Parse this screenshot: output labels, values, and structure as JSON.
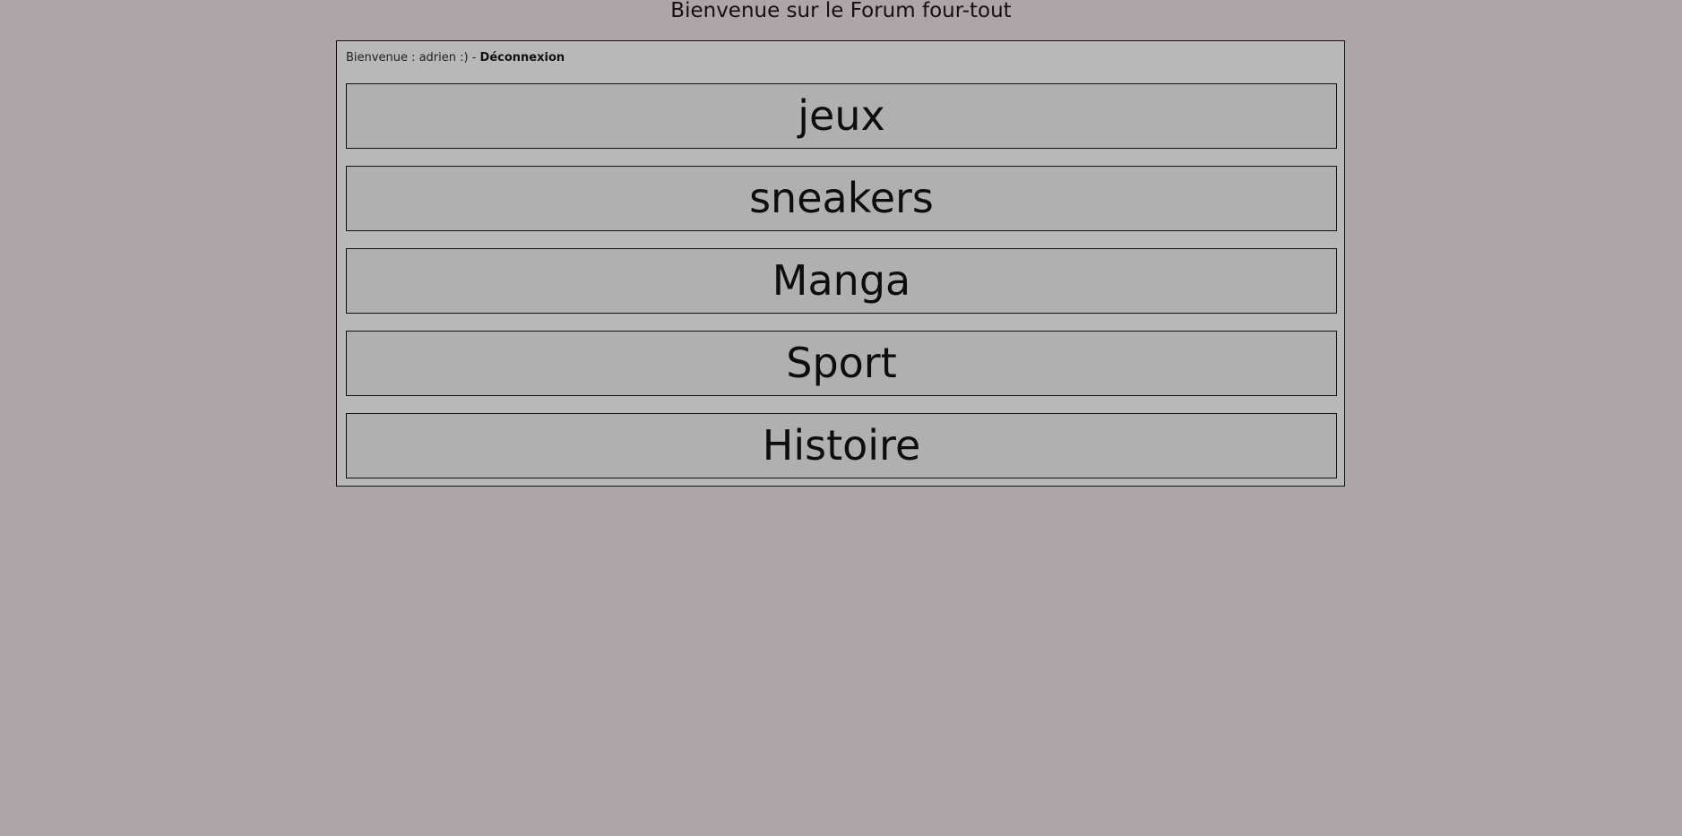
{
  "header": {
    "title": "Bienvenue sur le Forum four-tout"
  },
  "welcome": {
    "greeting": "Bienvenue : adrien :) - ",
    "logout_label": "Déconnexion"
  },
  "categories": [
    {
      "label": "jeux"
    },
    {
      "label": "sneakers"
    },
    {
      "label": "Manga"
    },
    {
      "label": "Sport"
    },
    {
      "label": "Histoire"
    }
  ],
  "colors": {
    "background": "#afa4a7",
    "panel": "#b8b8b8",
    "button": "#b0b0b0",
    "border": "#111111"
  }
}
